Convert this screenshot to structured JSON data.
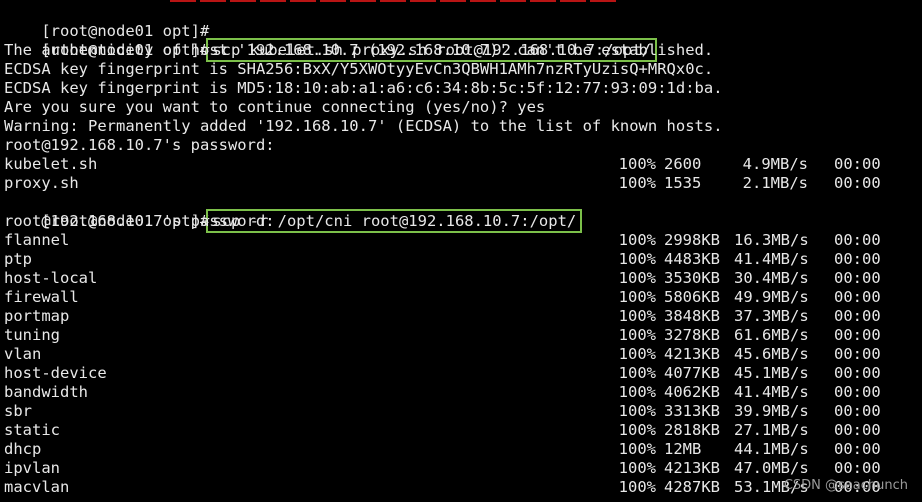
{
  "terminal": {
    "prompt_line_1": "[root@node01 opt]#",
    "prompt_1": "[root@node01 opt]#",
    "command_1": "scp kubelet.sh proxy.sh root@192.168.10.7:/opt/",
    "authenticity": "The authenticity of host '192.168.10.7 (192.168.10.7)' can't be established.",
    "fp_sha256": "ECDSA key fingerprint is SHA256:BxX/Y5XWOtyyEvCn3QBWH1AMh7nzRTyUzisQ+MRQx0c.",
    "fp_md5": "ECDSA key fingerprint is MD5:18:10:ab:a1:a6:c6:34:8b:5c:5f:12:77:93:09:1d:ba.",
    "confirm": "Are you sure you want to continue connecting (yes/no)? yes",
    "warning": "Warning: Permanently added '192.168.10.7' (ECDSA) to the list of known hosts.",
    "password_1": "root@192.168.10.7's password:",
    "transfers_1": [
      {
        "name": "kubelet.sh",
        "pct": "100%",
        "size": "2600",
        "rate": "4.9MB/s",
        "time": "00:00"
      },
      {
        "name": "proxy.sh",
        "pct": "100%",
        "size": "1535",
        "rate": "2.1MB/s",
        "time": "00:00"
      }
    ],
    "prompt_2": "[root@node01 opt]#",
    "command_2": "scp -r /opt/cni root@192.168.10.7:/opt/",
    "password_2": "root@192.168.10.7's password:",
    "transfers_2": [
      {
        "name": "flannel",
        "pct": "100%",
        "size": "2998KB",
        "rate": "16.3MB/s",
        "time": "00:00"
      },
      {
        "name": "ptp",
        "pct": "100%",
        "size": "4483KB",
        "rate": "41.4MB/s",
        "time": "00:00"
      },
      {
        "name": "host-local",
        "pct": "100%",
        "size": "3530KB",
        "rate": "30.4MB/s",
        "time": "00:00"
      },
      {
        "name": "firewall",
        "pct": "100%",
        "size": "5806KB",
        "rate": "49.9MB/s",
        "time": "00:00"
      },
      {
        "name": "portmap",
        "pct": "100%",
        "size": "3848KB",
        "rate": "37.3MB/s",
        "time": "00:00"
      },
      {
        "name": "tuning",
        "pct": "100%",
        "size": "3278KB",
        "rate": "61.6MB/s",
        "time": "00:00"
      },
      {
        "name": "vlan",
        "pct": "100%",
        "size": "4213KB",
        "rate": "45.6MB/s",
        "time": "00:00"
      },
      {
        "name": "host-device",
        "pct": "100%",
        "size": "4077KB",
        "rate": "45.1MB/s",
        "time": "00:00"
      },
      {
        "name": "bandwidth",
        "pct": "100%",
        "size": "4062KB",
        "rate": "41.4MB/s",
        "time": "00:00"
      },
      {
        "name": "sbr",
        "pct": "100%",
        "size": "3313KB",
        "rate": "39.9MB/s",
        "time": "00:00"
      },
      {
        "name": "static",
        "pct": "100%",
        "size": "2818KB",
        "rate": "27.1MB/s",
        "time": "00:00"
      },
      {
        "name": "dhcp",
        "pct": "100%",
        "size": "12MB",
        "rate": "44.1MB/s",
        "time": "00:00"
      },
      {
        "name": "ipvlan",
        "pct": "100%",
        "size": "4213KB",
        "rate": "47.0MB/s",
        "time": "00:00"
      },
      {
        "name": "macvlan",
        "pct": "100%",
        "size": "4287KB",
        "rate": "53.1MB/s",
        "time": "00:00"
      }
    ]
  },
  "watermark": "CSDN @seachunch",
  "colors": {
    "background": "#000000",
    "text": "#e8e8e8",
    "highlight_box": "#7cc04a"
  }
}
